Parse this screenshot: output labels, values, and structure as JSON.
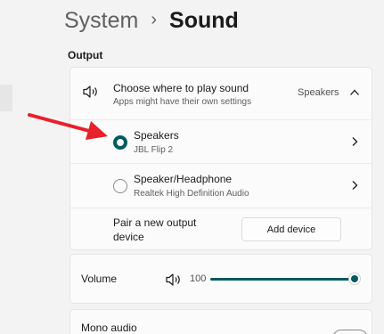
{
  "header": {
    "parent": "System",
    "separator": "›",
    "current": "Sound"
  },
  "output": {
    "section_label": "Output",
    "header_row": {
      "icon": "speaker-icon",
      "title": "Choose where to play sound",
      "subtitle": "Apps might have their own settings",
      "selected_value": "Speakers",
      "expand_icon": "chevron-up-icon"
    },
    "devices": [
      {
        "name": "Speakers",
        "subtitle": "JBL Flip 2",
        "selected": true
      },
      {
        "name": "Speaker/Headphone",
        "subtitle": "Realtek High Definition Audio",
        "selected": false
      }
    ],
    "pair": {
      "label": "Pair a new output device",
      "button_label": "Add device"
    }
  },
  "volume": {
    "label": "Volume",
    "icon": "speaker-icon",
    "value": "100",
    "level": 1.0
  },
  "mono": {
    "label": "Mono audio",
    "enabled": false
  },
  "colors": {
    "accent": "#005a61",
    "annotation_arrow": "#e8202a",
    "background": "#f3f3f3",
    "card": "#fbfbfb"
  }
}
